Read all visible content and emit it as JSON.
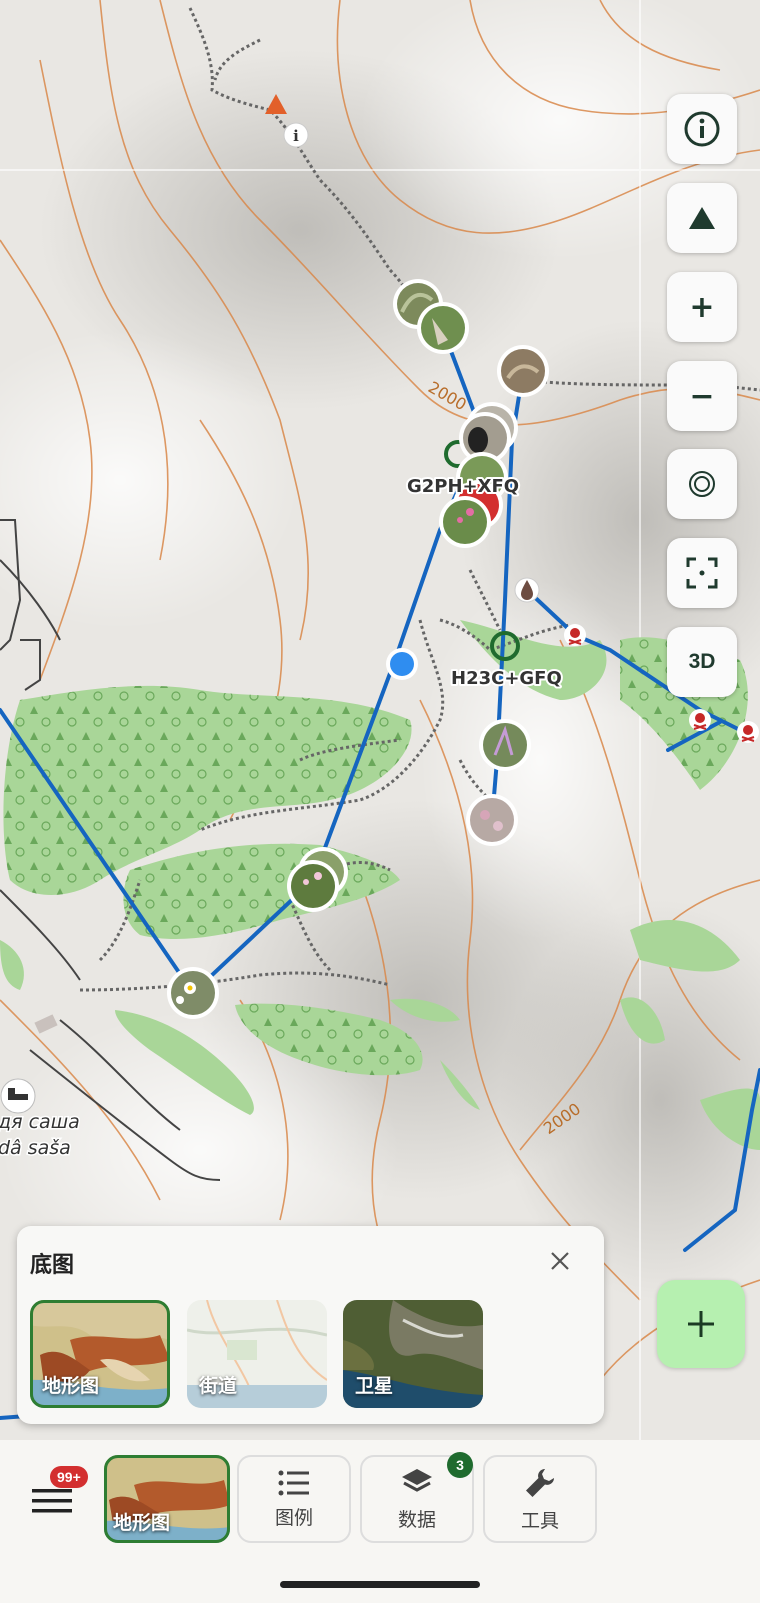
{
  "map": {
    "plus_codes": [
      "G2PH+XFQ",
      "H23C+GFQ"
    ],
    "contour_labels": [
      "2000",
      "2000"
    ],
    "place_names": [
      "дя саша",
      "dâ saša"
    ],
    "elevation_unit": ""
  },
  "controls": {
    "info_icon": "info-icon",
    "terrain_icon": "mountain-icon",
    "zoom_in": "+",
    "zoom_out": "−",
    "locate_icon": "target-icon",
    "fullscreen_icon": "fullscreen-icon",
    "three_d": "3D"
  },
  "basemap_panel": {
    "title": "底图",
    "options": [
      {
        "label": "地形图",
        "selected": true
      },
      {
        "label": "街道",
        "selected": false
      },
      {
        "label": "卫星",
        "selected": false
      }
    ]
  },
  "bottom_bar": {
    "menu_badge": "99+",
    "current_basemap": "地形图",
    "legend_label": "图例",
    "data_label": "数据",
    "data_badge": "3",
    "tools_label": "工具"
  },
  "colors": {
    "route": "#1565c0",
    "forest": "#9ed38c",
    "contour": "#d9884a",
    "accent_green": "#2e7d32",
    "fab_bg": "#b6f0b0"
  }
}
